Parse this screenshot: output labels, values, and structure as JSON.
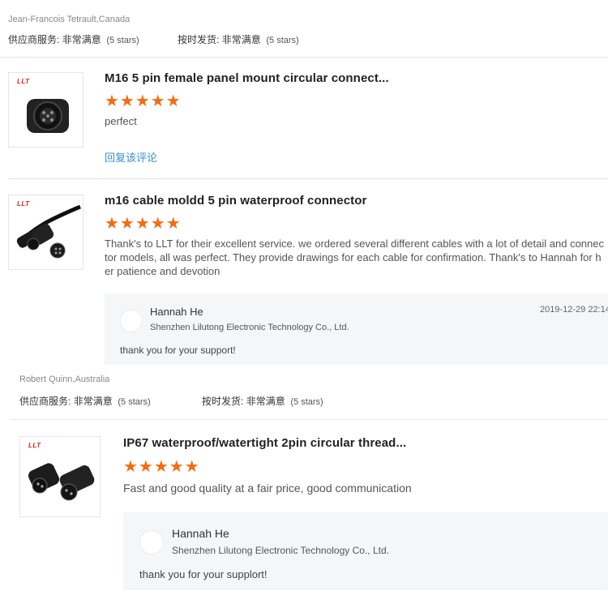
{
  "review1": {
    "reviewer": "Jean-Francois Tetrault,Canada",
    "service_label": "供应商服务:",
    "service_value": "非常满意",
    "service_stars": "(5 stars)",
    "delivery_label": "按时发货:",
    "delivery_value": "非常满意",
    "delivery_stars": "(5 stars)",
    "product_title": "M16 5 pin female panel mount circular connect...",
    "stars": "★★★★★",
    "comment": "perfect",
    "reply_link": "回复该评论",
    "logo": "LLT"
  },
  "review2": {
    "product_title": "m16 cable moldd 5 pin waterproof connector",
    "stars": "★★★★★",
    "comment_lines": [
      "Thank's to LLT for their excellent service. we ordered several different cables with a lot of detail and connec",
      "tor models, all was perfect. They provide drawings for each cable for confirmation. Thank's to Hannah for h",
      "er patience and devotion"
    ],
    "logo": "LLT",
    "reply": {
      "name": "Hannah He",
      "company": "Shenzhen Lilutong Electronic Technology Co., Ltd.",
      "date": "2019-12-29 22:14",
      "text": "thank you for your support!"
    }
  },
  "review3": {
    "reviewer": "Robert Quinn,Australia",
    "service_label": "供应商服务:",
    "service_value": "非常满意",
    "service_stars": "(5 stars)",
    "delivery_label": "按时发货:",
    "delivery_value": "非常满意",
    "delivery_stars": "(5 stars)",
    "product_title": "IP67 waterproof/watertight 2pin circular thread...",
    "stars": "★★★★★",
    "comment": "Fast and good quality at a fair price, good communication",
    "logo": "LLT",
    "reply": {
      "name": "Hannah He",
      "company": "Shenzhen Lilutong Electronic Technology Co., Ltd.",
      "text": "thank you for your supplort!"
    }
  },
  "colors": {
    "star": "#f26d12",
    "link": "#3a8fd6",
    "logo": "#d0261d"
  }
}
